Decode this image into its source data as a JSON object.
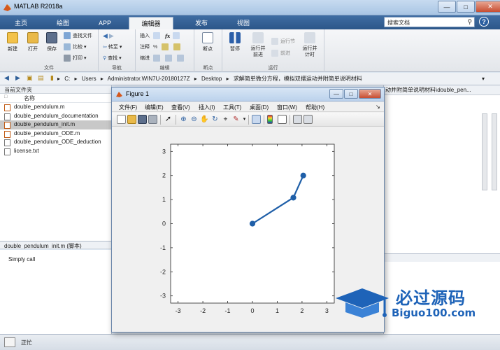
{
  "app": {
    "title": "MATLAB R2018a",
    "window_controls": {
      "minimize": "—",
      "maximize": "□",
      "close": "✕"
    }
  },
  "ribbon": {
    "tabs": [
      "主页",
      "绘图",
      "APP",
      "编辑器",
      "发布",
      "视图"
    ],
    "active_tab": "编辑器",
    "search_placeholder": "搜索文档",
    "help": "?",
    "groups": {
      "file": {
        "label": "文件",
        "new": "新建",
        "open": "打开",
        "save": "保存",
        "find_files": "查找文件",
        "compare": "比较",
        "print": "打印"
      },
      "navigate": {
        "label": "导航",
        "goto": "转至",
        "find": "查找"
      },
      "edit": {
        "label": "编辑",
        "insert": "插入",
        "comment": "注释",
        "indent": "缩进",
        "fx": "fx"
      },
      "breakpoints": {
        "label": "断点",
        "breakpoints": "断点"
      },
      "run": {
        "label": "运行",
        "pause": "暂停",
        "run_advance": "运行并\n前进",
        "run_section": "运行节",
        "advance": "前进",
        "run_time": "运行并\n计时"
      }
    }
  },
  "address": {
    "segments": [
      "C:",
      "Users",
      "Administrator.WIN7U-20180127Z",
      "Desktop",
      "求解简单微分方程，模拟双摆运动并附简单说明材料"
    ]
  },
  "folder_panel": {
    "title": "当前文件夹",
    "column_name": "名称",
    "files": [
      {
        "name": "double_pendulum.m",
        "type": "m",
        "selected": false
      },
      {
        "name": "double_pendulum_documentation",
        "type": "doc",
        "selected": false
      },
      {
        "name": "double_pendulum_init.m",
        "type": "m",
        "selected": true
      },
      {
        "name": "double_pendulum_ODE.m",
        "type": "m",
        "selected": false
      },
      {
        "name": "double_pendulum_ODE_deduction",
        "type": "doc",
        "selected": false
      },
      {
        "name": "license.txt",
        "type": "txt",
        "selected": false
      }
    ]
  },
  "details": {
    "header": "double_pendulum_init.m (脚本)",
    "body": "Simply call"
  },
  "editor": {
    "tab_title": "动并附简单说明材料\\double_pen..."
  },
  "status": {
    "text": "正忙"
  },
  "figure": {
    "title": "Figure 1",
    "menus": [
      "文件(F)",
      "编辑(E)",
      "查看(V)",
      "插入(I)",
      "工具(T)",
      "桌面(D)",
      "窗口(W)",
      "帮助(H)"
    ],
    "toolbar_icons": [
      "new-figure-icon",
      "open-icon",
      "save-icon",
      "print-icon",
      "pointer-icon",
      "zoom-in-icon",
      "zoom-out-icon",
      "pan-icon",
      "rotate-icon",
      "data-cursor-icon",
      "brush-icon",
      "link-icon",
      "colorbar-icon",
      "legend-icon",
      "hide-plot-tools-icon",
      "show-plot-tools-icon"
    ]
  },
  "chart_data": {
    "type": "line",
    "x": [
      0,
      1.65,
      2.05
    ],
    "y": [
      0,
      1.08,
      2.0
    ],
    "xlim": [
      -3.3,
      3.3
    ],
    "ylim": [
      -3.3,
      3.3
    ],
    "xticks": [
      -3,
      -2,
      -1,
      0,
      1,
      2,
      3
    ],
    "yticks": [
      -3,
      -2,
      -1,
      0,
      1,
      2,
      3
    ],
    "line_color": "#1f5fa8",
    "marker": "circle",
    "grid": false,
    "title": "",
    "xlabel": "",
    "ylabel": ""
  },
  "watermark": {
    "brand": "必过源码",
    "url": "Biguo100.com"
  },
  "colors": {
    "ribbon_tab_bar": "#2c5689",
    "accent": "#1f5fa8",
    "selected_row": "#c8c8c8"
  }
}
